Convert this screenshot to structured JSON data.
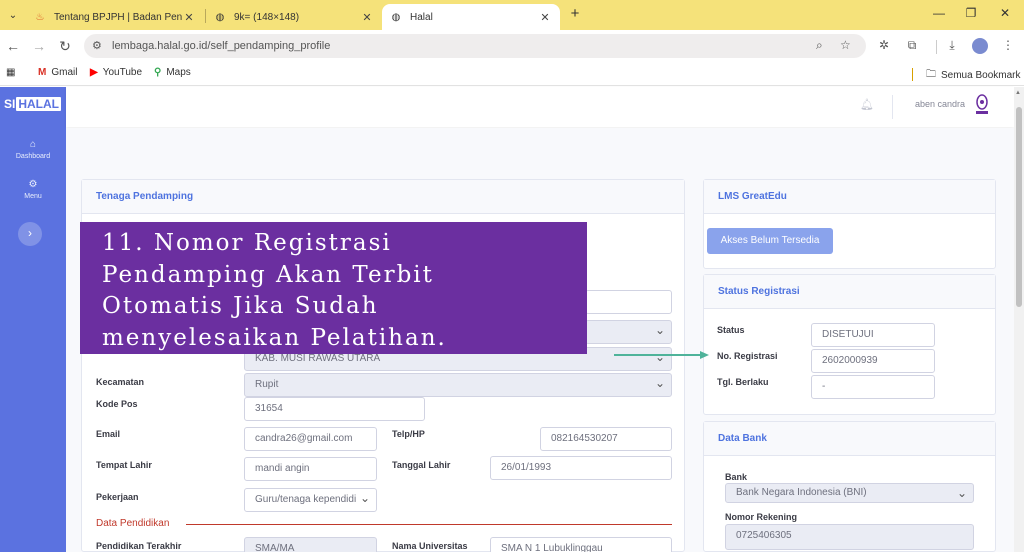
{
  "browser": {
    "tabs": [
      {
        "title": "Tentang BPJPH | Badan Penyelenggara",
        "favicon": "flame-icon"
      },
      {
        "title": "9k= (148×148)",
        "favicon": "globe-icon"
      },
      {
        "title": "Halal",
        "favicon": "globe-icon"
      }
    ],
    "url": "lembaga.halal.go.id/self_pendamping_profile",
    "bookmarks": [
      {
        "label": "Gmail"
      },
      {
        "label": "YouTube"
      },
      {
        "label": "Maps"
      }
    ],
    "bookmarks_folder": "Semua Bookmark",
    "tab_bar_color": "#f5e27a"
  },
  "app": {
    "logo_left": "SI",
    "logo_right": "HALAL",
    "sidebar_items": [
      {
        "label": "Dashboard",
        "icon": "dashboard-icon"
      },
      {
        "label": "Menu",
        "icon": "gear-icon"
      }
    ],
    "user_name": "aben candra",
    "accent_color": "#4e73df"
  },
  "profile_card": {
    "title": "Tenaga Pendamping",
    "fields": {
      "kab_value": "KAB. MUSI RAWAS UTARA",
      "kecamatan_label": "Kecamatan",
      "kecamatan_value": "Rupit",
      "kodepos_label": "Kode Pos",
      "kodepos_value": "31654",
      "email_label": "Email",
      "email_value": "candra26@gmail.com",
      "telp_label": "Telp/HP",
      "telp_value": "082164530207",
      "tempat_label": "Tempat Lahir",
      "tempat_value": "mandi angin",
      "tanggal_label": "Tanggal Lahir",
      "tanggal_value": "26/01/1993",
      "pekerjaan_label": "Pekerjaan",
      "pekerjaan_value": "Guru/tenaga kependidi",
      "pendidikan_section": "Data Pendidikan",
      "pendidikan_label": "Pendidikan Terakhir",
      "pendidikan_value": "SMA/MA",
      "universitas_label": "Nama Universitas",
      "universitas_value": "SMA N 1 Lubuklinggau"
    }
  },
  "lms_card": {
    "title": "LMS GreatEdu",
    "button": "Akses Belum Tersedia"
  },
  "status_card": {
    "title": "Status Registrasi",
    "status_label": "Status",
    "status_value": "DISETUJUI",
    "noreg_label": "No. Registrasi",
    "noreg_value": "2602000939",
    "berlaku_label": "Tgl. Berlaku",
    "berlaku_value": "-"
  },
  "bank_card": {
    "title": "Data Bank",
    "bank_label": "Bank",
    "bank_value": "Bank Negara Indonesia (BNI)",
    "rekening_label": "Nomor Rekening",
    "rekening_value": "0725406305"
  },
  "overlay": {
    "lines": [
      "11. Nomor Registrasi",
      "Pendamping Akan Terbit",
      "Otomatis Jika Sudah",
      "menyelesaikan Pelatihan."
    ],
    "color": "#6b2fa0"
  }
}
